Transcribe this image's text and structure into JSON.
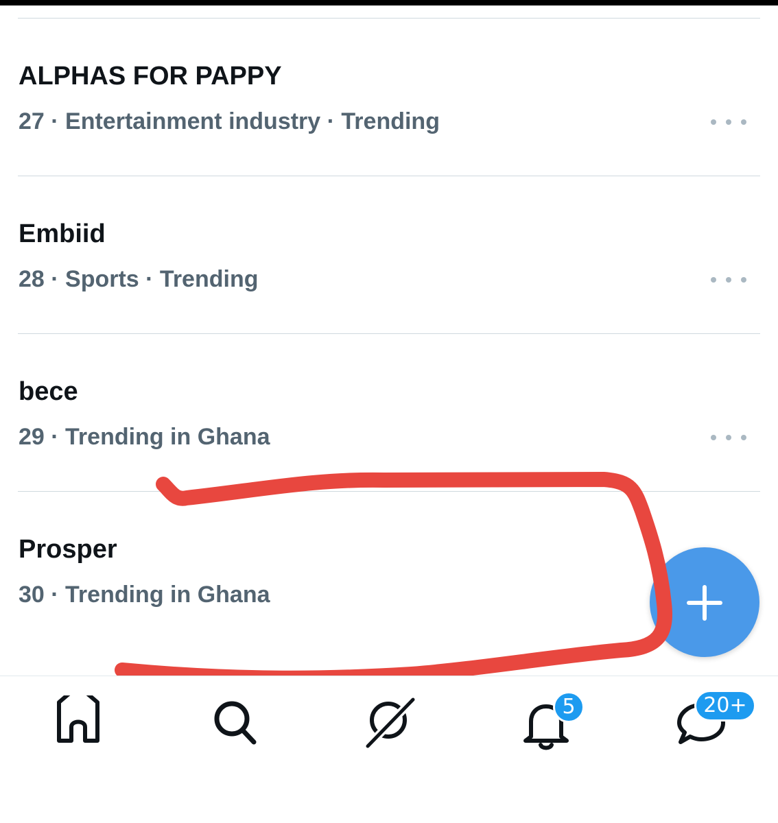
{
  "trends": [
    {
      "title": "ALPHAS FOR PAPPY",
      "meta": "27 · Entertainment industry · Trending"
    },
    {
      "title": "Embiid",
      "meta": "28 · Sports · Trending"
    },
    {
      "title": "bece",
      "meta": "29 · Trending in Ghana"
    },
    {
      "title": "Prosper",
      "meta": "30 · Trending in Ghana"
    }
  ],
  "fab": {
    "icon": "plus-icon"
  },
  "bottom_nav": {
    "items": [
      {
        "icon": "home-icon"
      },
      {
        "icon": "search-icon"
      },
      {
        "icon": "grok-icon"
      },
      {
        "icon": "bell-icon",
        "badge": "5"
      },
      {
        "icon": "messages-icon",
        "badge": "20+"
      }
    ]
  },
  "colors": {
    "accent": "#1d9bf0",
    "fab": "#4a99e9",
    "annotation": "#e8473f",
    "text_primary": "#0f1419",
    "text_secondary": "#536471"
  }
}
